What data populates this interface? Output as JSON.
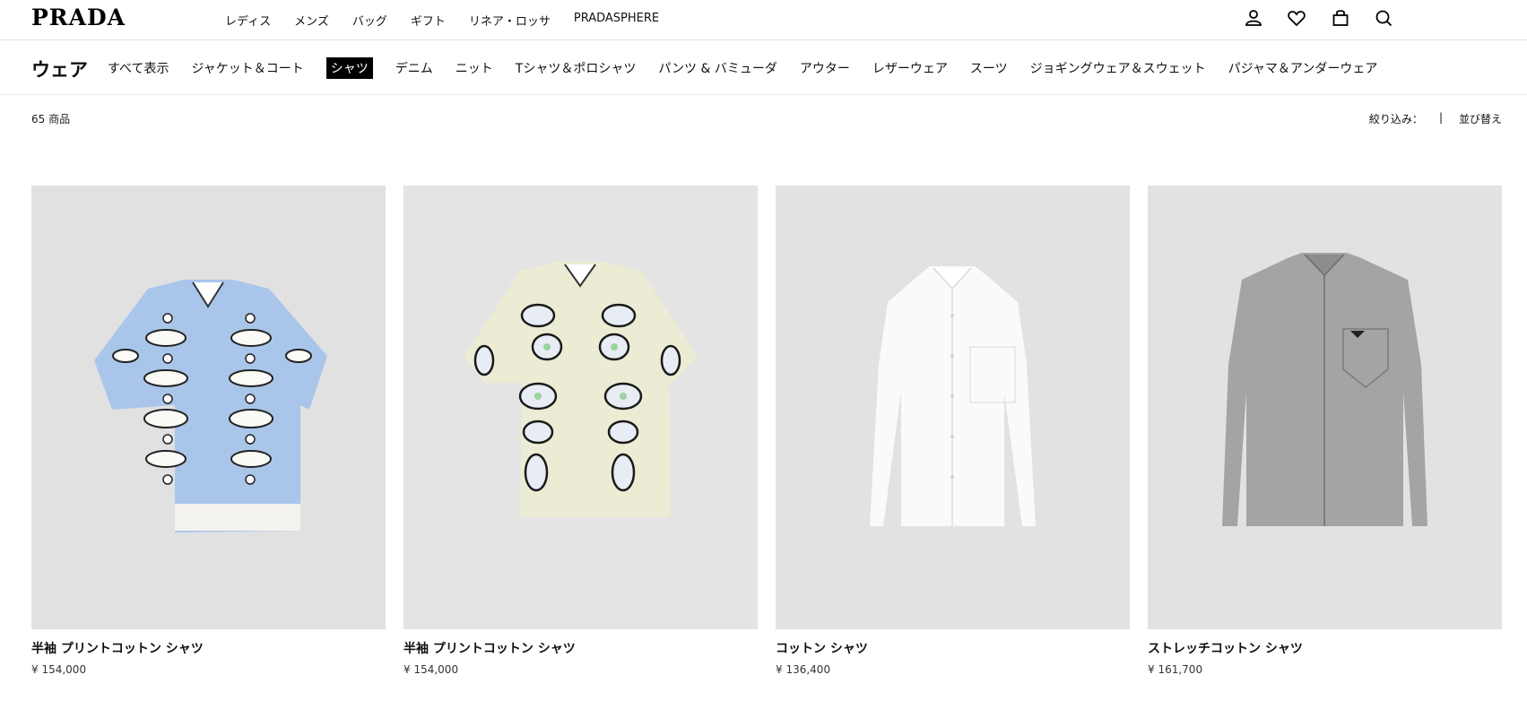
{
  "header": {
    "logo": "PRADA",
    "nav": [
      "レディス",
      "メンズ",
      "バッグ",
      "ギフト",
      "リネア・ロッサ",
      "PRADASPHERE"
    ],
    "icons": [
      "account-icon",
      "wishlist-heart-icon",
      "shopping-bag-icon",
      "search-icon"
    ]
  },
  "category": {
    "title": "ウェア",
    "items": [
      "すべて表示",
      "ジャケット＆コート",
      "シャツ",
      "デニム",
      "ニット",
      "Tシャツ＆ポロシャツ",
      "パンツ & バミューダ",
      "アウター",
      "レザーウェア",
      "スーツ",
      "ジョギングウェア＆スウェット",
      "パジャマ＆アンダーウェア"
    ],
    "active": "シャツ"
  },
  "listing": {
    "count": "65 商品",
    "filter_label": "絞り込み：",
    "separator": "|",
    "sort_label": "並び替え"
  },
  "products": [
    {
      "name": "半袖 プリントコットン シャツ",
      "price": "¥ 154,000",
      "color": "#a9c6ea",
      "print": "blue-white floral"
    },
    {
      "name": "半袖 プリントコットン シャツ",
      "price": "¥ 154,000",
      "color": "#ecebd4",
      "print": "cream floral"
    },
    {
      "name": "コットン シャツ",
      "price": "¥ 136,400",
      "color": "#fafafa",
      "print": "plain white"
    },
    {
      "name": "ストレッチコットン シャツ",
      "price": "¥ 161,700",
      "color": "#a6a3a4",
      "print": "grey zip"
    }
  ]
}
